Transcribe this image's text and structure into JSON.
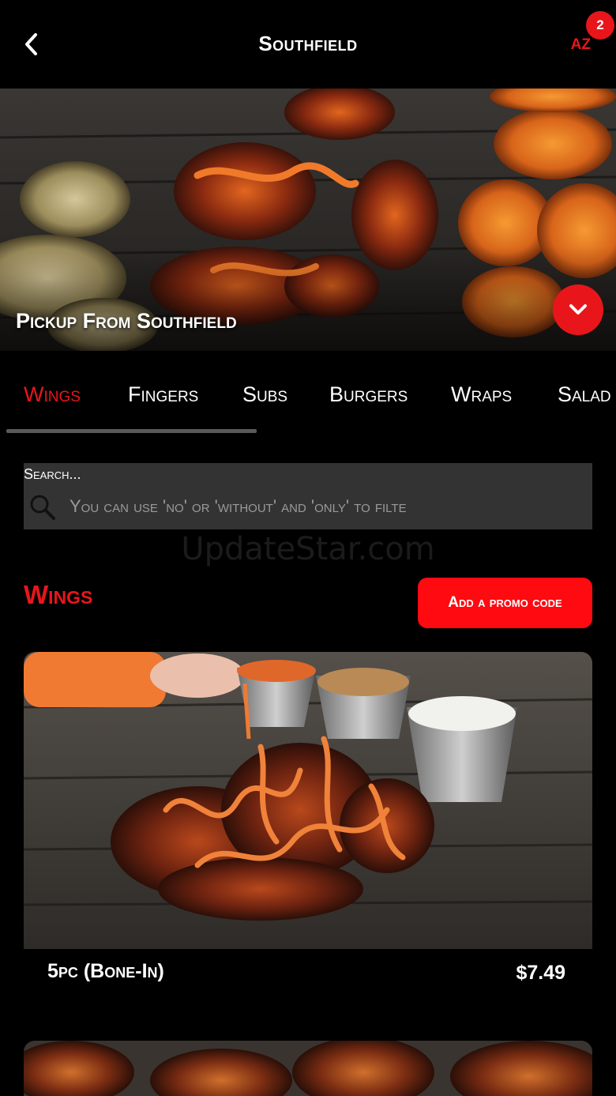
{
  "header": {
    "title": "Southfield",
    "initials": "AZ",
    "cart_count": "2",
    "back_icon": "chevron-left-icon"
  },
  "hero": {
    "label": "Pickup From Southfield",
    "toggle_icon": "chevron-down-icon"
  },
  "tabs": [
    {
      "label": "Wings",
      "active": true
    },
    {
      "label": "Fingers",
      "active": false
    },
    {
      "label": "Subs",
      "active": false
    },
    {
      "label": "Burgers",
      "active": false
    },
    {
      "label": "Wraps",
      "active": false
    },
    {
      "label": "Salad",
      "active": false
    }
  ],
  "search": {
    "label": "Search...",
    "placeholder": "You can use 'no' or 'without' and 'only' to filte",
    "icon": "search-icon"
  },
  "watermark": "UpdateStar.com",
  "section": {
    "title": "Wings",
    "promo_label": "Add a promo code"
  },
  "items": [
    {
      "name": "5pc (Bone-In)",
      "price": "$7.49"
    }
  ],
  "colors": {
    "accent": "#e8161b",
    "background": "#000000",
    "search_bg": "#333333"
  }
}
